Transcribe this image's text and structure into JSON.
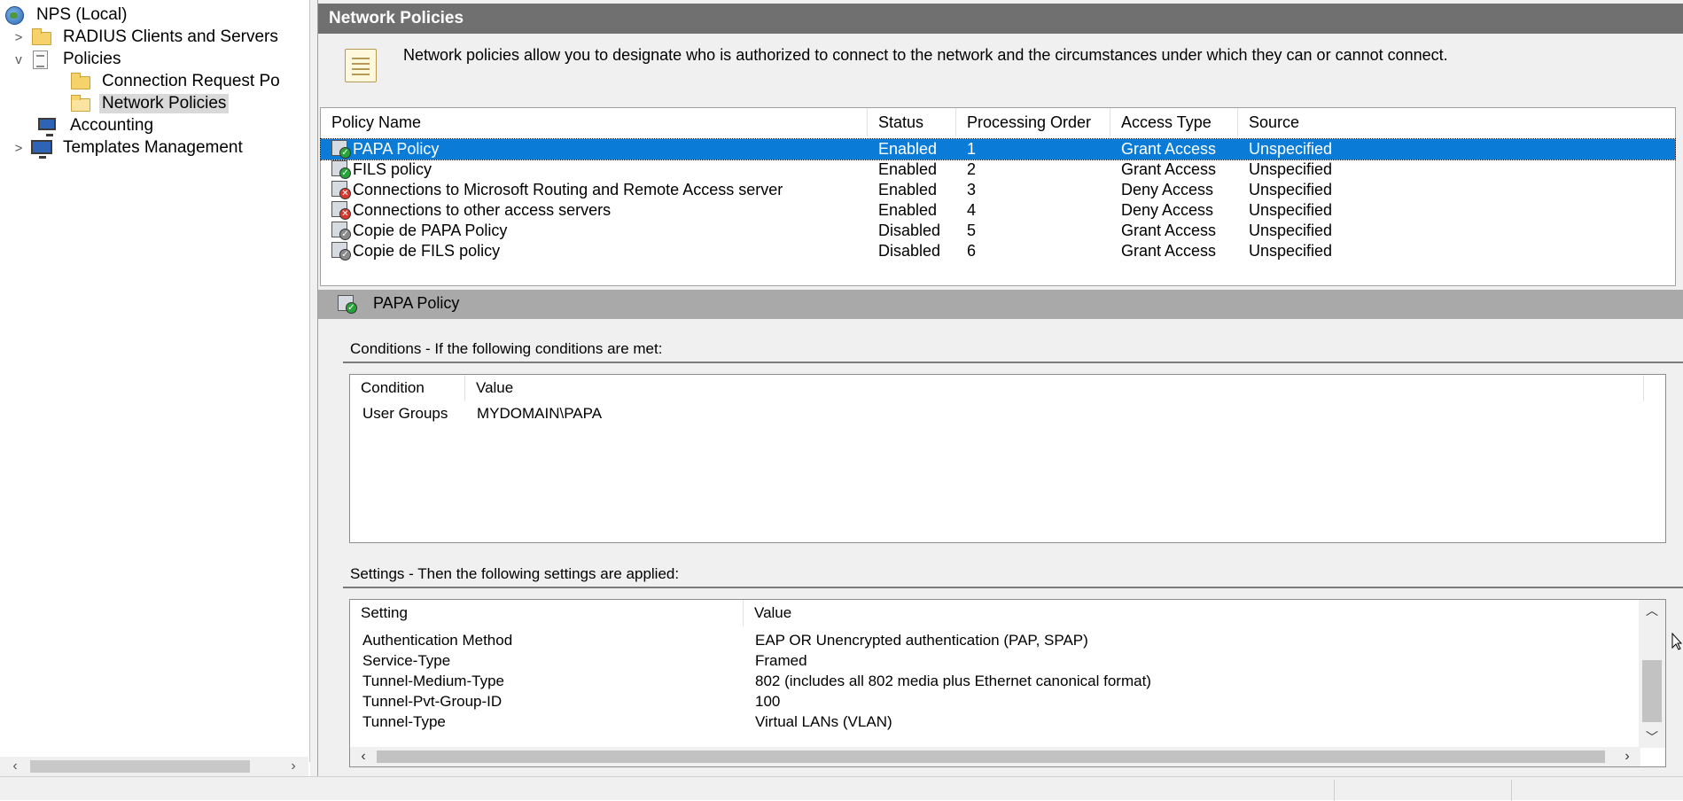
{
  "tree": {
    "items": [
      {
        "label": "NPS (Local)",
        "icon": "globe-icon",
        "expander": ""
      },
      {
        "label": "RADIUS Clients and Servers",
        "icon": "folder-icon",
        "expander": ">"
      },
      {
        "label": "Policies",
        "icon": "policies-icon",
        "expander": "v"
      },
      {
        "label": "Connection Request Po",
        "icon": "folder-icon",
        "expander": ""
      },
      {
        "label": "Network Policies",
        "icon": "open-folder-icon",
        "expander": ""
      },
      {
        "label": "Accounting",
        "icon": "accounting-icon",
        "expander": ""
      },
      {
        "label": "Templates Management",
        "icon": "templates-icon",
        "expander": ">"
      }
    ],
    "selected": "Network Policies"
  },
  "panel": {
    "title": "Network Policies",
    "description": "Network policies allow you to designate who is authorized to connect to the network and the circumstances under which they can or cannot connect."
  },
  "policies": {
    "columns": [
      "Policy Name",
      "Status",
      "Processing Order",
      "Access Type",
      "Source"
    ],
    "rows": [
      {
        "name": "PAPA Policy",
        "status": "Enabled",
        "order": "1",
        "access": "Grant Access",
        "source": "Unspecified",
        "badge": "grant",
        "badge_glyph": "✓"
      },
      {
        "name": "FILS policy",
        "status": "Enabled",
        "order": "2",
        "access": "Grant Access",
        "source": "Unspecified",
        "badge": "grant",
        "badge_glyph": "✓"
      },
      {
        "name": "Connections to Microsoft Routing and Remote Access server",
        "status": "Enabled",
        "order": "3",
        "access": "Deny Access",
        "source": "Unspecified",
        "badge": "deny",
        "badge_glyph": "✕"
      },
      {
        "name": "Connections to other access servers",
        "status": "Enabled",
        "order": "4",
        "access": "Deny Access",
        "source": "Unspecified",
        "badge": "deny",
        "badge_glyph": "✕"
      },
      {
        "name": "Copie de PAPA Policy",
        "status": "Disabled",
        "order": "5",
        "access": "Grant Access",
        "source": "Unspecified",
        "badge": "off",
        "badge_glyph": "✓"
      },
      {
        "name": "Copie de FILS policy",
        "status": "Disabled",
        "order": "6",
        "access": "Grant Access",
        "source": "Unspecified",
        "badge": "off",
        "badge_glyph": "✓"
      }
    ],
    "selected_index": 0
  },
  "detail": {
    "title": "PAPA Policy",
    "conditions_label": "Conditions - If the following conditions are met:",
    "conditions_columns": [
      "Condition",
      "Value"
    ],
    "conditions": [
      {
        "condition": "User Groups",
        "value": "MYDOMAIN\\PAPA"
      }
    ],
    "settings_label": "Settings - Then the following settings are applied:",
    "settings_columns": [
      "Setting",
      "Value"
    ],
    "settings": [
      {
        "setting": "Authentication Method",
        "value": "EAP OR Unencrypted authentication (PAP, SPAP)"
      },
      {
        "setting": "Service-Type",
        "value": "Framed"
      },
      {
        "setting": "Tunnel-Medium-Type",
        "value": "802 (includes all 802 media plus Ethernet canonical format)"
      },
      {
        "setting": "Tunnel-Pvt-Group-ID",
        "value": "100"
      },
      {
        "setting": "Tunnel-Type",
        "value": "Virtual LANs (VLAN)"
      }
    ]
  },
  "colors": {
    "selection": "#0a7bd6",
    "header_bar": "#707070",
    "detail_bar": "#a9a9a9",
    "grant_badge": "#27a33b",
    "deny_badge": "#d63a2f"
  }
}
